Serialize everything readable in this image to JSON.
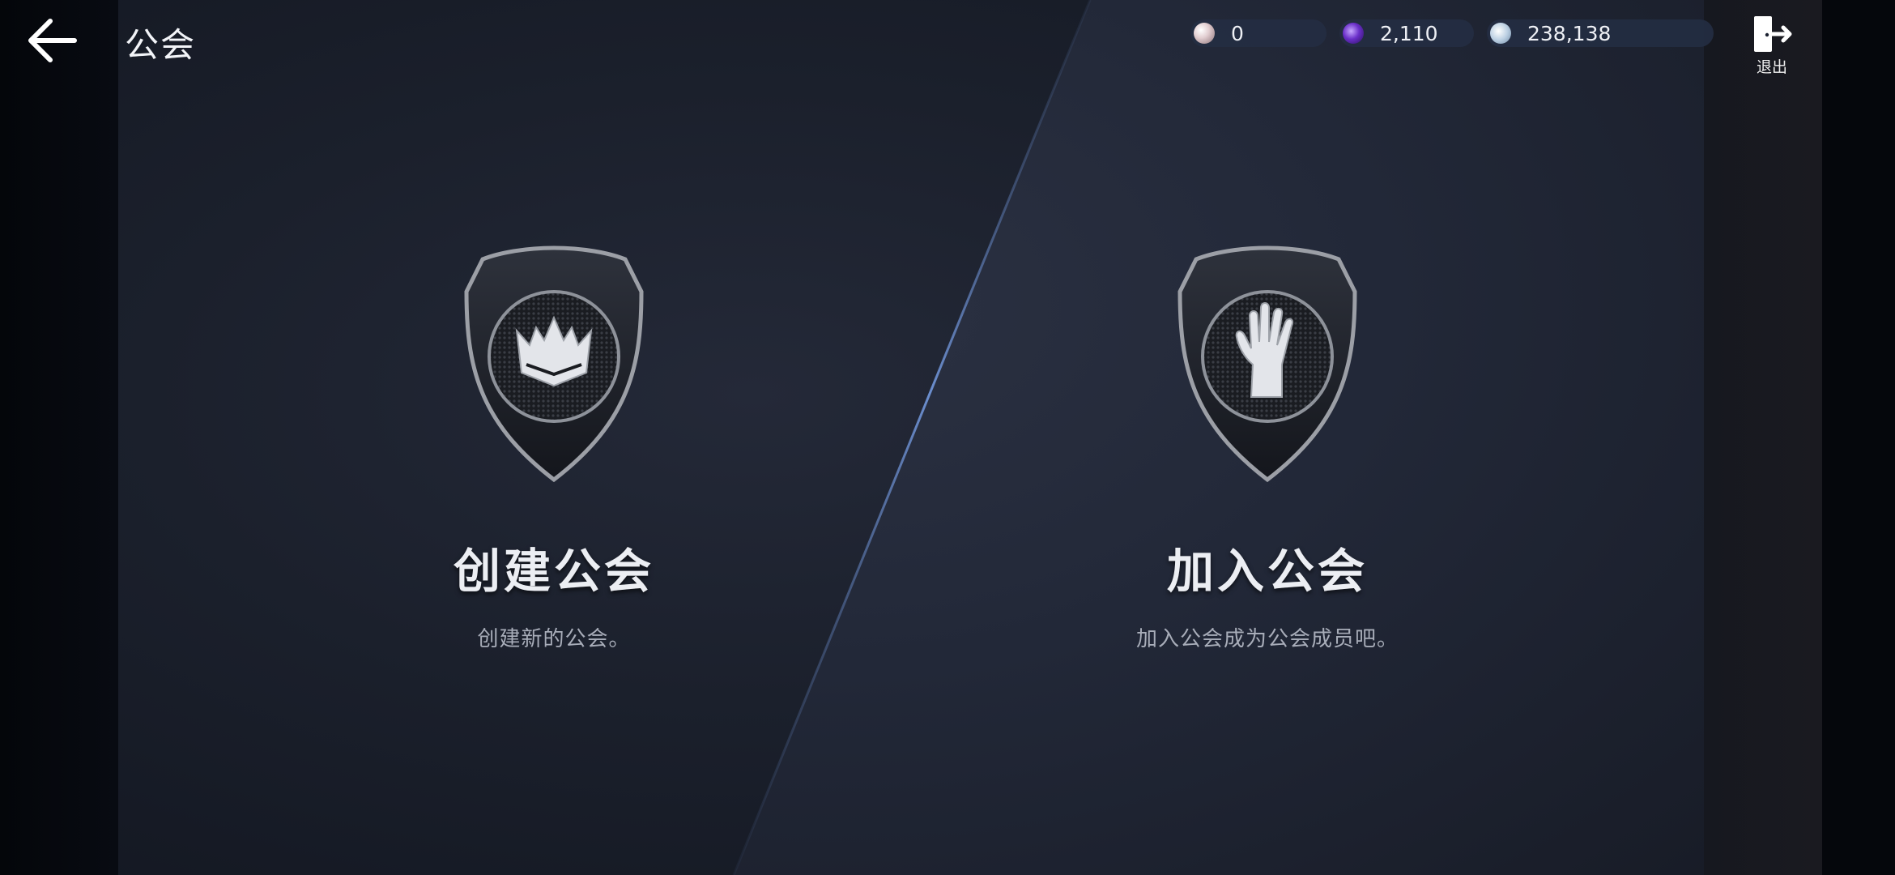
{
  "header": {
    "title": "公会",
    "exit_label": "退出"
  },
  "currencies": [
    {
      "name": "pearl",
      "icon": "pearl-icon",
      "value": "0",
      "color": "#d9c6c9"
    },
    {
      "name": "gem",
      "icon": "purple-orb-icon",
      "value": "2,110",
      "color": "#6a2fc9"
    },
    {
      "name": "coin",
      "icon": "silver-coin-icon",
      "value": "238,138",
      "color": "#b9cde0"
    }
  ],
  "options": {
    "create": {
      "title": "创建公会",
      "description": "创建新的公会。",
      "icon": "crown-emblem-icon"
    },
    "join": {
      "title": "加入公会",
      "description": "加入公会成为公会成员吧。",
      "icon": "hand-emblem-icon"
    }
  },
  "colors": {
    "panel_left": "#1b202c",
    "panel_right": "#222838",
    "divider_glow": "#5b7fc4"
  }
}
